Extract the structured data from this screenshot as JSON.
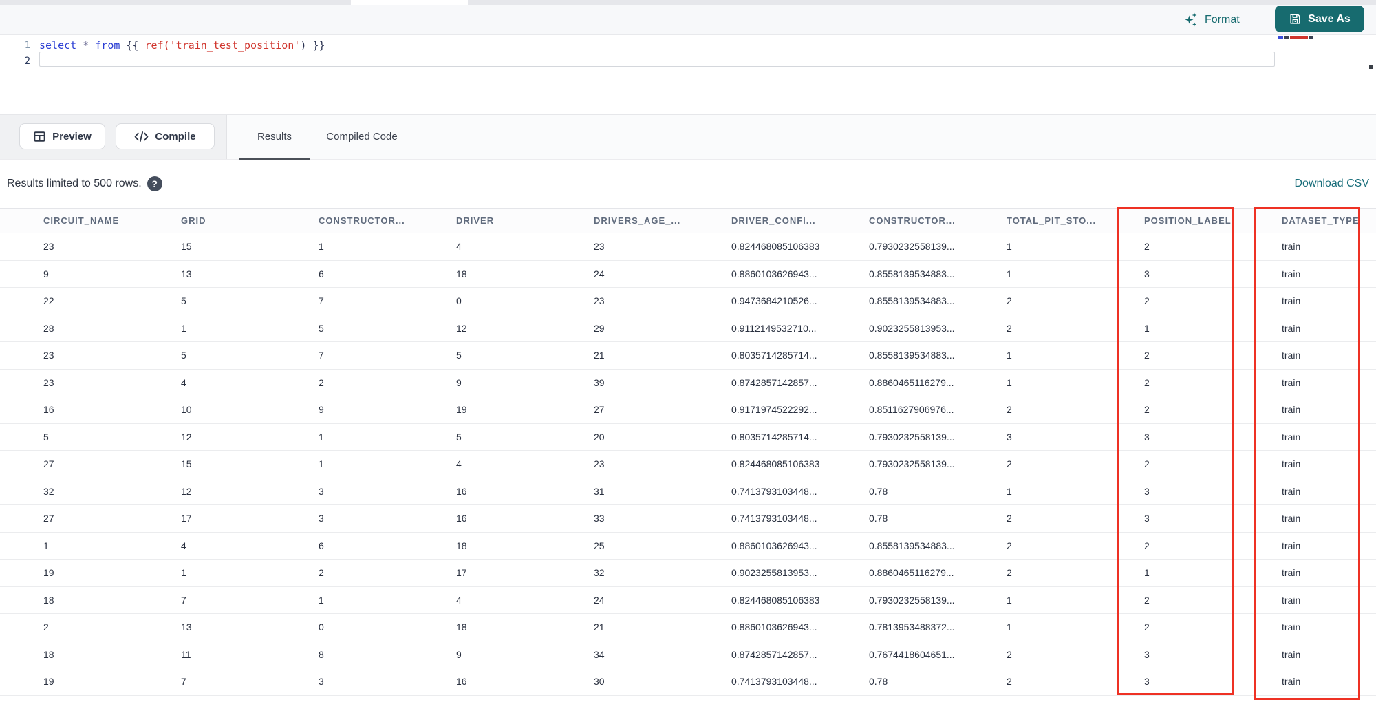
{
  "colors": {
    "accent_teal": "#176b6f",
    "highlight_red": "#ee3124",
    "link_teal": "#186d7a"
  },
  "topbar": {
    "format_label": "Format",
    "save_as_label": "Save As"
  },
  "editor": {
    "line_numbers": [
      "1",
      "2"
    ],
    "code_plain": "select * from {{ ref('train_test_position') }}",
    "line1_tokens": [
      {
        "t": "select",
        "c": "kw"
      },
      {
        "t": " ",
        "c": "plain"
      },
      {
        "t": "*",
        "c": "op"
      },
      {
        "t": " ",
        "c": "plain"
      },
      {
        "t": "from",
        "c": "kw"
      },
      {
        "t": " ",
        "c": "plain"
      },
      {
        "t": "{{",
        "c": "brace"
      },
      {
        "t": " ",
        "c": "plain"
      },
      {
        "t": "ref(",
        "c": "fn"
      },
      {
        "t": "'train_test_position'",
        "c": "str"
      },
      {
        "t": ")",
        "c": "brace"
      },
      {
        "t": " ",
        "c": "plain"
      },
      {
        "t": "}}",
        "c": "brace"
      }
    ]
  },
  "toolbar": {
    "preview_label": "Preview",
    "compile_label": "Compile",
    "tabs": [
      {
        "label": "Results",
        "active": true
      },
      {
        "label": "Compiled Code",
        "active": false
      }
    ]
  },
  "results_bar": {
    "notice": "Results limited to 500 rows.",
    "help_glyph": "?",
    "download_label": "Download CSV"
  },
  "table": {
    "columns": [
      "CIRCUIT_NAME",
      "GRID",
      "CONSTRUCTOR...",
      "DRIVER",
      "DRIVERS_AGE_...",
      "DRIVER_CONFI...",
      "CONSTRUCTOR...",
      "TOTAL_PIT_STO...",
      "POSITION_LABEL",
      "DATASET_TYPE"
    ],
    "rows": [
      [
        "23",
        "15",
        "1",
        "4",
        "23",
        "0.824468085106383",
        "0.7930232558139...",
        "1",
        "2",
        "train"
      ],
      [
        "9",
        "13",
        "6",
        "18",
        "24",
        "0.8860103626943...",
        "0.8558139534883...",
        "1",
        "3",
        "train"
      ],
      [
        "22",
        "5",
        "7",
        "0",
        "23",
        "0.9473684210526...",
        "0.8558139534883...",
        "2",
        "2",
        "train"
      ],
      [
        "28",
        "1",
        "5",
        "12",
        "29",
        "0.9112149532710...",
        "0.9023255813953...",
        "2",
        "1",
        "train"
      ],
      [
        "23",
        "5",
        "7",
        "5",
        "21",
        "0.8035714285714...",
        "0.8558139534883...",
        "1",
        "2",
        "train"
      ],
      [
        "23",
        "4",
        "2",
        "9",
        "39",
        "0.8742857142857...",
        "0.8860465116279...",
        "1",
        "2",
        "train"
      ],
      [
        "16",
        "10",
        "9",
        "19",
        "27",
        "0.9171974522292...",
        "0.8511627906976...",
        "2",
        "2",
        "train"
      ],
      [
        "5",
        "12",
        "1",
        "5",
        "20",
        "0.8035714285714...",
        "0.7930232558139...",
        "3",
        "3",
        "train"
      ],
      [
        "27",
        "15",
        "1",
        "4",
        "23",
        "0.824468085106383",
        "0.7930232558139...",
        "2",
        "2",
        "train"
      ],
      [
        "32",
        "12",
        "3",
        "16",
        "31",
        "0.7413793103448...",
        "0.78",
        "1",
        "3",
        "train"
      ],
      [
        "27",
        "17",
        "3",
        "16",
        "33",
        "0.7413793103448...",
        "0.78",
        "2",
        "3",
        "train"
      ],
      [
        "1",
        "4",
        "6",
        "18",
        "25",
        "0.8860103626943...",
        "0.8558139534883...",
        "2",
        "2",
        "train"
      ],
      [
        "19",
        "1",
        "2",
        "17",
        "32",
        "0.9023255813953...",
        "0.8860465116279...",
        "2",
        "1",
        "train"
      ],
      [
        "18",
        "7",
        "1",
        "4",
        "24",
        "0.824468085106383",
        "0.7930232558139...",
        "1",
        "2",
        "train"
      ],
      [
        "2",
        "13",
        "0",
        "18",
        "21",
        "0.8860103626943...",
        "0.7813953488372...",
        "1",
        "2",
        "train"
      ],
      [
        "18",
        "11",
        "8",
        "9",
        "34",
        "0.8742857142857...",
        "0.7674418604651...",
        "2",
        "3",
        "train"
      ],
      [
        "19",
        "7",
        "3",
        "16",
        "30",
        "0.7413793103448...",
        "0.78",
        "2",
        "3",
        "train"
      ]
    ]
  },
  "highlights": {
    "boxes": [
      {
        "column": "POSITION_LABEL"
      },
      {
        "column": "DATASET_TYPE"
      }
    ]
  }
}
